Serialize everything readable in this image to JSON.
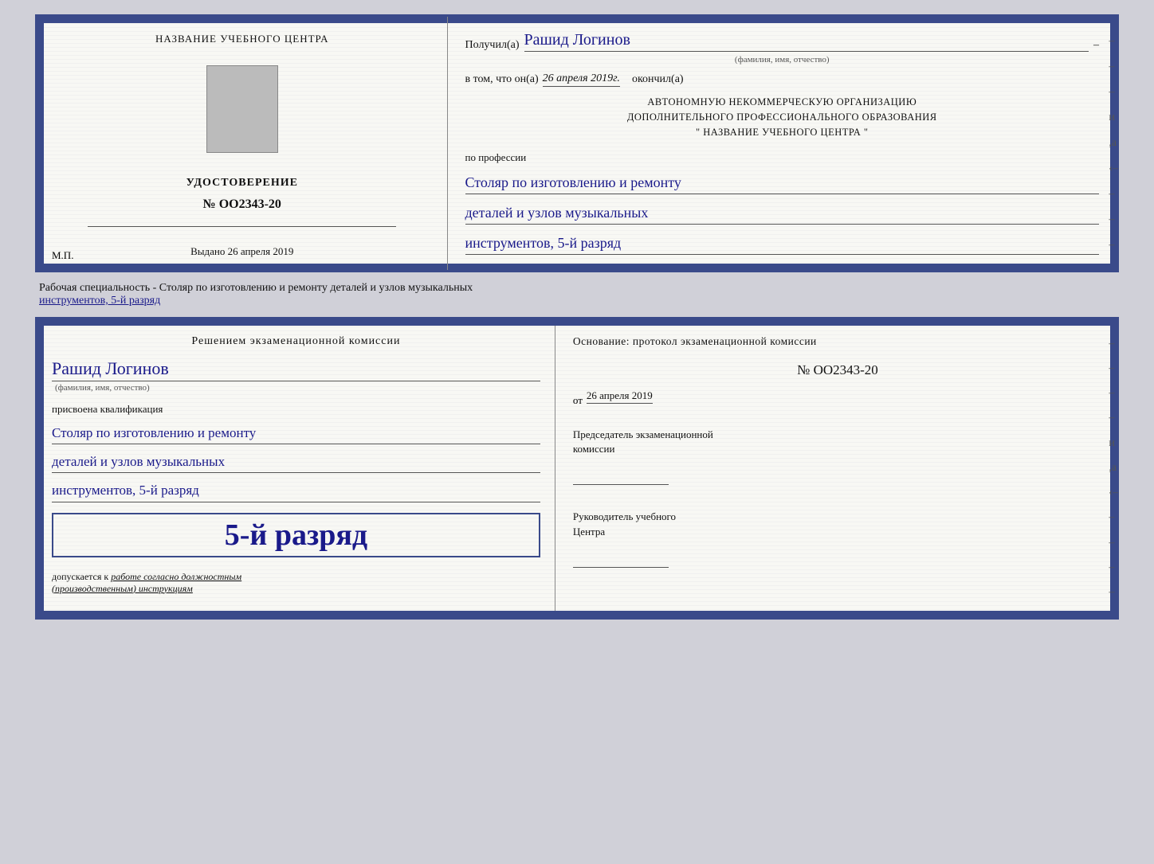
{
  "top_cert": {
    "left": {
      "title": "НАЗВАНИЕ УЧЕБНОГО ЦЕНТРА",
      "udostoverenie": "УДОСТОВЕРЕНИЕ",
      "number": "№ OO2343-20",
      "vydano_prefix": "Выдано",
      "vydano_date": "26 апреля 2019",
      "mp": "М.П."
    },
    "right": {
      "poluchil_prefix": "Получил(а)",
      "name": "Рашид Логинов",
      "dash": "–",
      "fio_label": "(фамилия, имя, отчество)",
      "vtom_prefix": "в том, что он(а)",
      "date_italic": "26 апреля 2019г.",
      "okonchil": "окончил(а)",
      "org_line1": "АВТОНОМНУЮ НЕКОММЕРЧЕСКУЮ ОРГАНИЗАЦИЮ",
      "org_line2": "ДОПОЛНИТЕЛЬНОГО ПРОФЕССИОНАЛЬНОГО ОБРАЗОВАНИЯ",
      "org_line3": "\"  НАЗВАНИЕ УЧЕБНОГО ЦЕНТРА  \"",
      "po_professii": "по профессии",
      "profession1": "Столяр по изготовлению и ремонту",
      "profession2": "деталей и узлов музыкальных",
      "profession3": "инструментов, 5-й разряд"
    }
  },
  "specialty_bar": {
    "prefix": "Рабочая специальность - Столяр по изготовлению и ремонту деталей и узлов музыкальных",
    "underline": "инструментов, 5-й разряд"
  },
  "bottom_cert": {
    "left": {
      "decision": "Решением экзаменационной комиссии",
      "name": "Рашид Логинов",
      "fio_label": "(фамилия, имя, отчество)",
      "prisvoena": "присвоена квалификация",
      "qualification1": "Столяр по изготовлению и ремонту",
      "qualification2": "деталей и узлов музыкальных",
      "qualification3": "инструментов, 5-й разряд",
      "razryad_big": "5-й разряд",
      "dopuskaetsya_prefix": "допускается к",
      "dopuskaetsya_italic": "работе согласно должностным",
      "dopuskaetsya_italic2": "(производственным) инструкциям"
    },
    "right": {
      "osnovanie": "Основание: протокол экзаменационной  комиссии",
      "protocol_number": "№  OO2343-20",
      "ot_prefix": "от",
      "ot_date": "26 апреля 2019",
      "chairman_line1": "Председатель экзаменационной",
      "chairman_line2": "комиссии",
      "rukovoditel_line1": "Руководитель учебного",
      "rukovoditel_line2": "Центра"
    }
  }
}
